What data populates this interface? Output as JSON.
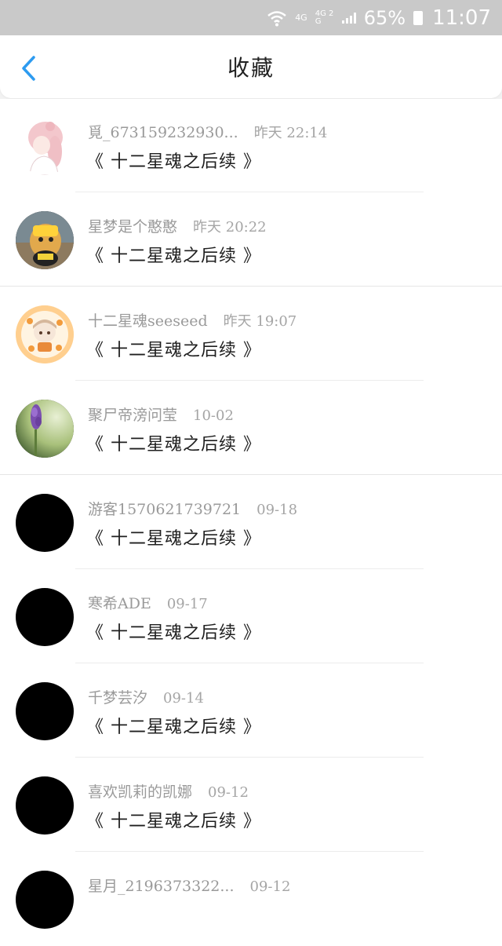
{
  "status_bar": {
    "network_top": "4G",
    "network_bottom": "4G 2G",
    "battery_percent": "65%",
    "time": "11:07"
  },
  "header": {
    "title": "收藏",
    "back_icon": "chevron-left-icon",
    "accent_color": "#2d9bf0"
  },
  "favorites": [
    {
      "user": "覓_673159232930...",
      "time": "昨天 22:14",
      "book": "《 十二星魂之后续 》",
      "avatar": "girl-illustration"
    },
    {
      "user": "星梦是个憨憨",
      "time": "昨天 20:22",
      "book": "《 十二星魂之后续 》",
      "avatar": "duck-plush-photo"
    },
    {
      "user": "十二星魂seeseed",
      "time": "昨天 19:07",
      "book": "《 十二星魂之后续 》",
      "avatar": "chibi-illustration"
    },
    {
      "user": "聚尸帝滂问莹",
      "time": "10-02",
      "book": "《 十二星魂之后续 》",
      "avatar": "purple-flower-photo"
    },
    {
      "user": "游客1570621739721",
      "time": "09-18",
      "book": "《 十二星魂之后续 》",
      "avatar": "default-black"
    },
    {
      "user": "寒希ADE",
      "time": "09-17",
      "book": "《 十二星魂之后续 》",
      "avatar": "default-black"
    },
    {
      "user": "千梦芸汐",
      "time": "09-14",
      "book": "《 十二星魂之后续 》",
      "avatar": "default-black"
    },
    {
      "user": "喜欢凯莉的凯娜",
      "time": "09-12",
      "book": "《 十二星魂之后续 》",
      "avatar": "default-black"
    },
    {
      "user": "星月_2196373322...",
      "time": "09-12",
      "book": "",
      "avatar": "default-black"
    }
  ]
}
